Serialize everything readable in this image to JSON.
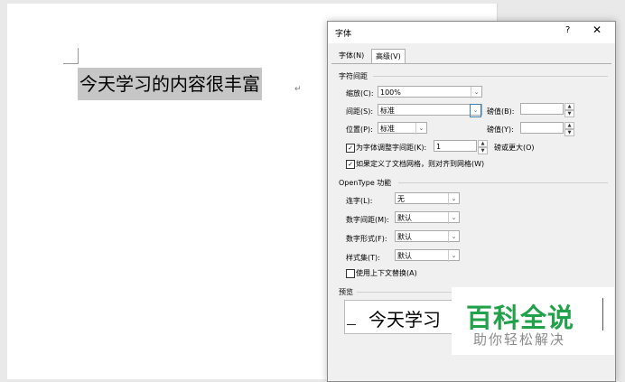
{
  "document": {
    "text": "今天学习的内容很丰富",
    "paragraph_mark": "↵"
  },
  "dialog": {
    "title": "字体",
    "help": "?",
    "close": "✕",
    "tabs": [
      "字体(N)",
      "高级(V)"
    ],
    "char_spacing": {
      "section": "字符间距",
      "scale_label": "缩放(C):",
      "scale_value": "100%",
      "spacing_label": "间距(S):",
      "spacing_value": "标准",
      "spacing_pts_label": "磅值(B):",
      "position_label": "位置(P):",
      "position_value": "标准",
      "position_pts_label": "磅值(Y):",
      "kerning_label": "为字体调整字间距(K):",
      "kerning_value": "1",
      "kerning_suffix": "磅或更大(O)",
      "grid_label": "如果定义了文档网格，则对齐到网格(W)"
    },
    "opentype": {
      "section": "OpenType 功能",
      "ligatures_label": "连字(L):",
      "ligatures_value": "无",
      "spacing_label": "数字间距(M):",
      "spacing_value": "默认",
      "forms_label": "数字形式(F):",
      "forms_value": "默认",
      "stylistic_label": "样式集(T):",
      "stylistic_value": "默认",
      "contextual_label": "使用上下文替换(A)"
    },
    "preview": {
      "section": "预览",
      "text": "今天学习"
    }
  },
  "watermark": {
    "title": "百科全说",
    "subtitle": "助你轻松解决"
  },
  "icons": {
    "dropdown": "chevron-down-icon",
    "check": "checkmark-icon"
  }
}
